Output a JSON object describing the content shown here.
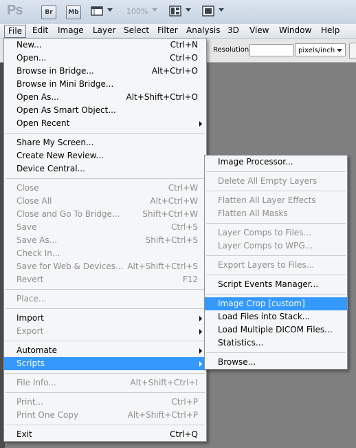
{
  "app": {
    "logo": "Ps",
    "toolbar": {
      "bridge_label": "Br",
      "minibridge_label": "Mb",
      "zoom_value": "100%"
    }
  },
  "menubar": [
    "File",
    "Edit",
    "Image",
    "Layer",
    "Select",
    "Filter",
    "Analysis",
    "3D",
    "View",
    "Window",
    "Help"
  ],
  "options": {
    "resolution_label": "Resolution:",
    "resolution_value": "",
    "unit_value": "pixels/inch"
  },
  "file_menu": {
    "groups": [
      [
        {
          "label": "New...",
          "shortcut": "Ctrl+N",
          "disabled": false
        },
        {
          "label": "Open...",
          "shortcut": "Ctrl+O",
          "disabled": false
        },
        {
          "label": "Browse in Bridge...",
          "shortcut": "Alt+Ctrl+O",
          "disabled": false
        },
        {
          "label": "Browse in Mini Bridge...",
          "shortcut": "",
          "disabled": false
        },
        {
          "label": "Open As...",
          "shortcut": "Alt+Shift+Ctrl+O",
          "disabled": false
        },
        {
          "label": "Open As Smart Object...",
          "shortcut": "",
          "disabled": false
        },
        {
          "label": "Open Recent",
          "shortcut": "",
          "disabled": false,
          "submenu": true
        }
      ],
      [
        {
          "label": "Share My Screen...",
          "shortcut": "",
          "disabled": false
        },
        {
          "label": "Create New Review...",
          "shortcut": "",
          "disabled": false
        },
        {
          "label": "Device Central...",
          "shortcut": "",
          "disabled": false
        }
      ],
      [
        {
          "label": "Close",
          "shortcut": "Ctrl+W",
          "disabled": true
        },
        {
          "label": "Close All",
          "shortcut": "Alt+Ctrl+W",
          "disabled": true
        },
        {
          "label": "Close and Go To Bridge...",
          "shortcut": "Shift+Ctrl+W",
          "disabled": true
        },
        {
          "label": "Save",
          "shortcut": "Ctrl+S",
          "disabled": true
        },
        {
          "label": "Save As...",
          "shortcut": "Shift+Ctrl+S",
          "disabled": true
        },
        {
          "label": "Check In...",
          "shortcut": "",
          "disabled": true
        },
        {
          "label": "Save for Web & Devices...",
          "shortcut": "Alt+Shift+Ctrl+S",
          "disabled": true
        },
        {
          "label": "Revert",
          "shortcut": "F12",
          "disabled": true
        }
      ],
      [
        {
          "label": "Place...",
          "shortcut": "",
          "disabled": true
        }
      ],
      [
        {
          "label": "Import",
          "shortcut": "",
          "disabled": false,
          "submenu": true
        },
        {
          "label": "Export",
          "shortcut": "",
          "disabled": true,
          "submenu": true
        }
      ],
      [
        {
          "label": "Automate",
          "shortcut": "",
          "disabled": false,
          "submenu": true
        },
        {
          "label": "Scripts",
          "shortcut": "",
          "disabled": false,
          "submenu": true,
          "highlighted": true
        }
      ],
      [
        {
          "label": "File Info...",
          "shortcut": "Alt+Shift+Ctrl+I",
          "disabled": true
        }
      ],
      [
        {
          "label": "Print...",
          "shortcut": "Ctrl+P",
          "disabled": true
        },
        {
          "label": "Print One Copy",
          "shortcut": "Alt+Shift+Ctrl+P",
          "disabled": true
        }
      ],
      [
        {
          "label": "Exit",
          "shortcut": "Ctrl+Q",
          "disabled": false
        }
      ]
    ]
  },
  "scripts_menu": {
    "groups": [
      [
        {
          "label": "Image Processor...",
          "disabled": false
        }
      ],
      [
        {
          "label": "Delete All Empty Layers",
          "disabled": true
        }
      ],
      [
        {
          "label": "Flatten All Layer Effects",
          "disabled": true
        },
        {
          "label": "Flatten All Masks",
          "disabled": true
        }
      ],
      [
        {
          "label": "Layer Comps to Files...",
          "disabled": true
        },
        {
          "label": "Layer Comps to WPG...",
          "disabled": true
        }
      ],
      [
        {
          "label": "Export Layers to Files...",
          "disabled": true
        }
      ],
      [
        {
          "label": "Script Events Manager...",
          "disabled": false
        }
      ],
      [
        {
          "label": "Image Crop [custom]",
          "disabled": false,
          "highlighted": true
        },
        {
          "label": "Load Files into Stack...",
          "disabled": false
        },
        {
          "label": "Load Multiple DICOM Files...",
          "disabled": false
        },
        {
          "label": "Statistics...",
          "disabled": false
        }
      ],
      [
        {
          "label": "Browse...",
          "disabled": false
        }
      ]
    ]
  },
  "colors": {
    "highlight": "#3399ff",
    "disabled_text": "#8d8d8d",
    "workspace": "#7f7f7f"
  }
}
